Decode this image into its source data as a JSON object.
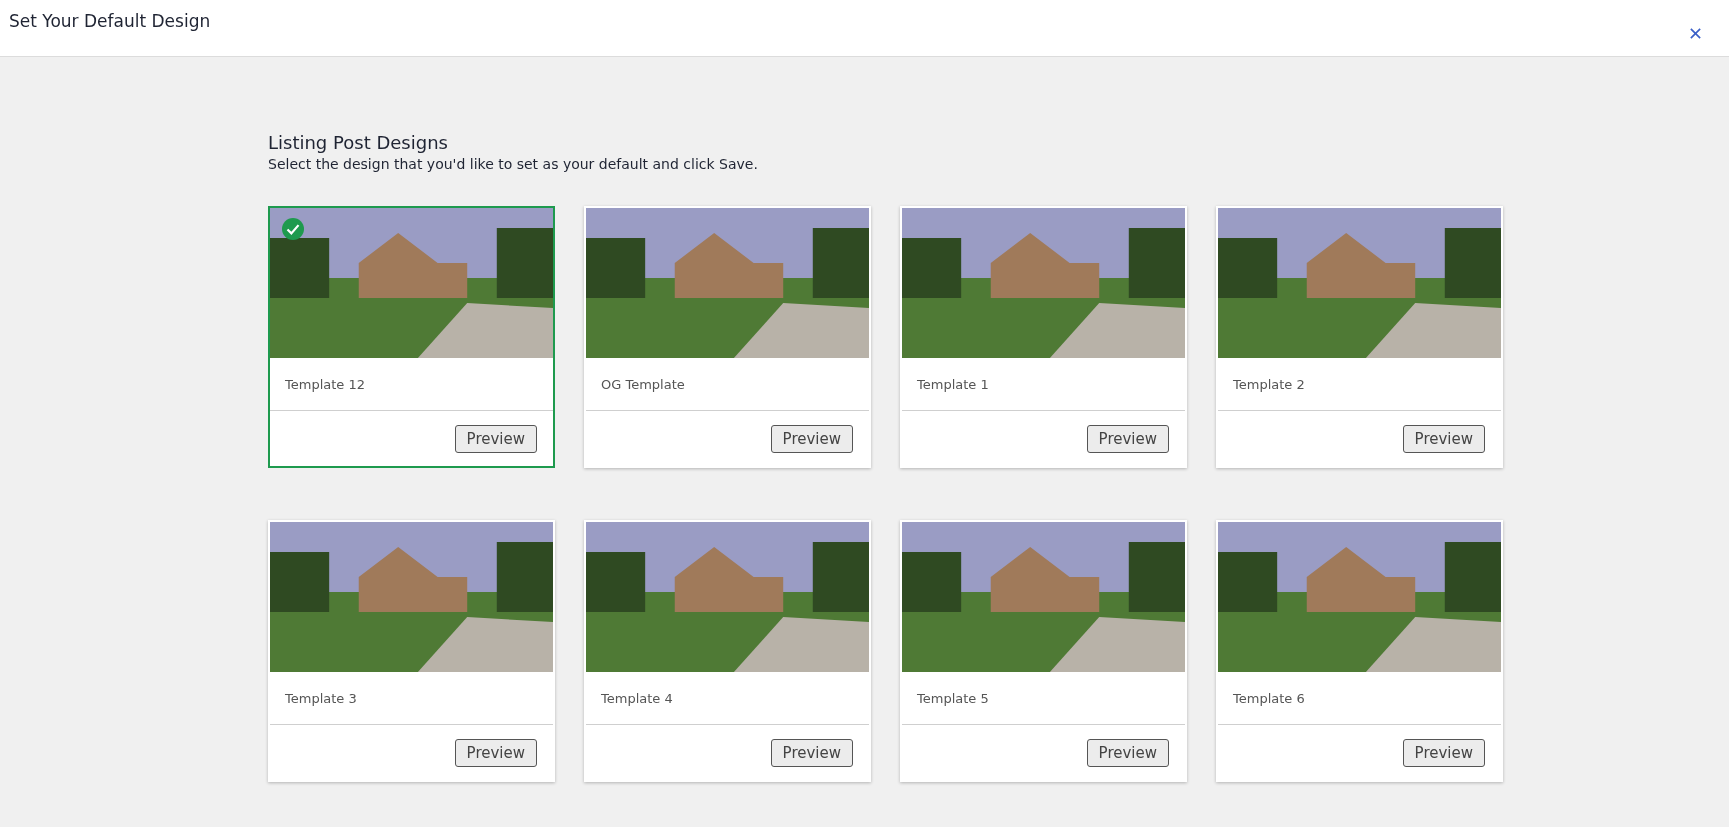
{
  "header": {
    "title": "Set Your Default Design"
  },
  "section": {
    "title": "Listing Post Designs",
    "subtitle": "Select the design that you'd like to set as your default and click Save."
  },
  "templates": [
    {
      "name": "Template 12",
      "selected": true,
      "button": "Preview"
    },
    {
      "name": "OG Template",
      "selected": false,
      "button": "Preview"
    },
    {
      "name": "Template 1",
      "selected": false,
      "button": "Preview"
    },
    {
      "name": "Template 2",
      "selected": false,
      "button": "Preview"
    },
    {
      "name": "Template 3",
      "selected": false,
      "button": "Preview"
    },
    {
      "name": "Template 4",
      "selected": false,
      "button": "Preview"
    },
    {
      "name": "Template 5",
      "selected": false,
      "button": "Preview"
    },
    {
      "name": "Template 6",
      "selected": false,
      "button": "Preview"
    }
  ]
}
